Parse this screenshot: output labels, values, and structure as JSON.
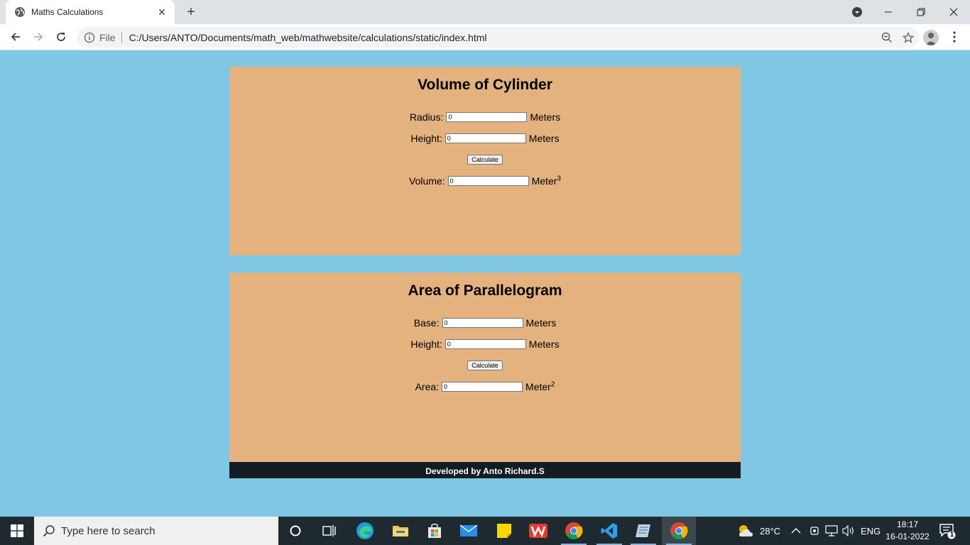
{
  "browser": {
    "tab_title": "Maths Calculations",
    "omnibox_scheme": "File",
    "url": "C:/Users/ANTO/Documents/math_web/mathwebsite/calculations/static/index.html"
  },
  "cylinder": {
    "title": "Volume of Cylinder",
    "radius_label": "Radius:",
    "radius_value": "0",
    "radius_unit": "Meters",
    "height_label": "Height:",
    "height_value": "0",
    "height_unit": "Meters",
    "button": "Calculate",
    "volume_label": "Volume:",
    "volume_value": "0",
    "volume_unit": "Meter",
    "volume_exp": "3"
  },
  "parallelogram": {
    "title": "Area of Parallelogram",
    "base_label": "Base:",
    "base_value": "0",
    "base_unit": "Meters",
    "height_label": "Height:",
    "height_value": "0",
    "height_unit": "Meters",
    "button": "Calculate",
    "area_label": "Area:",
    "area_value": "0",
    "area_unit": "Meter",
    "area_exp": "2"
  },
  "footer": "Developed by Anto Richard.S",
  "taskbar": {
    "search_placeholder": "Type here to search",
    "weather": "28°C",
    "language": "ENG",
    "time": "18:17",
    "date": "16-01-2022",
    "notification_count": "1"
  },
  "colors": {
    "page_bg": "#80c7e5",
    "card_bg": "#e4b27e",
    "footer_bg": "#131c22"
  }
}
